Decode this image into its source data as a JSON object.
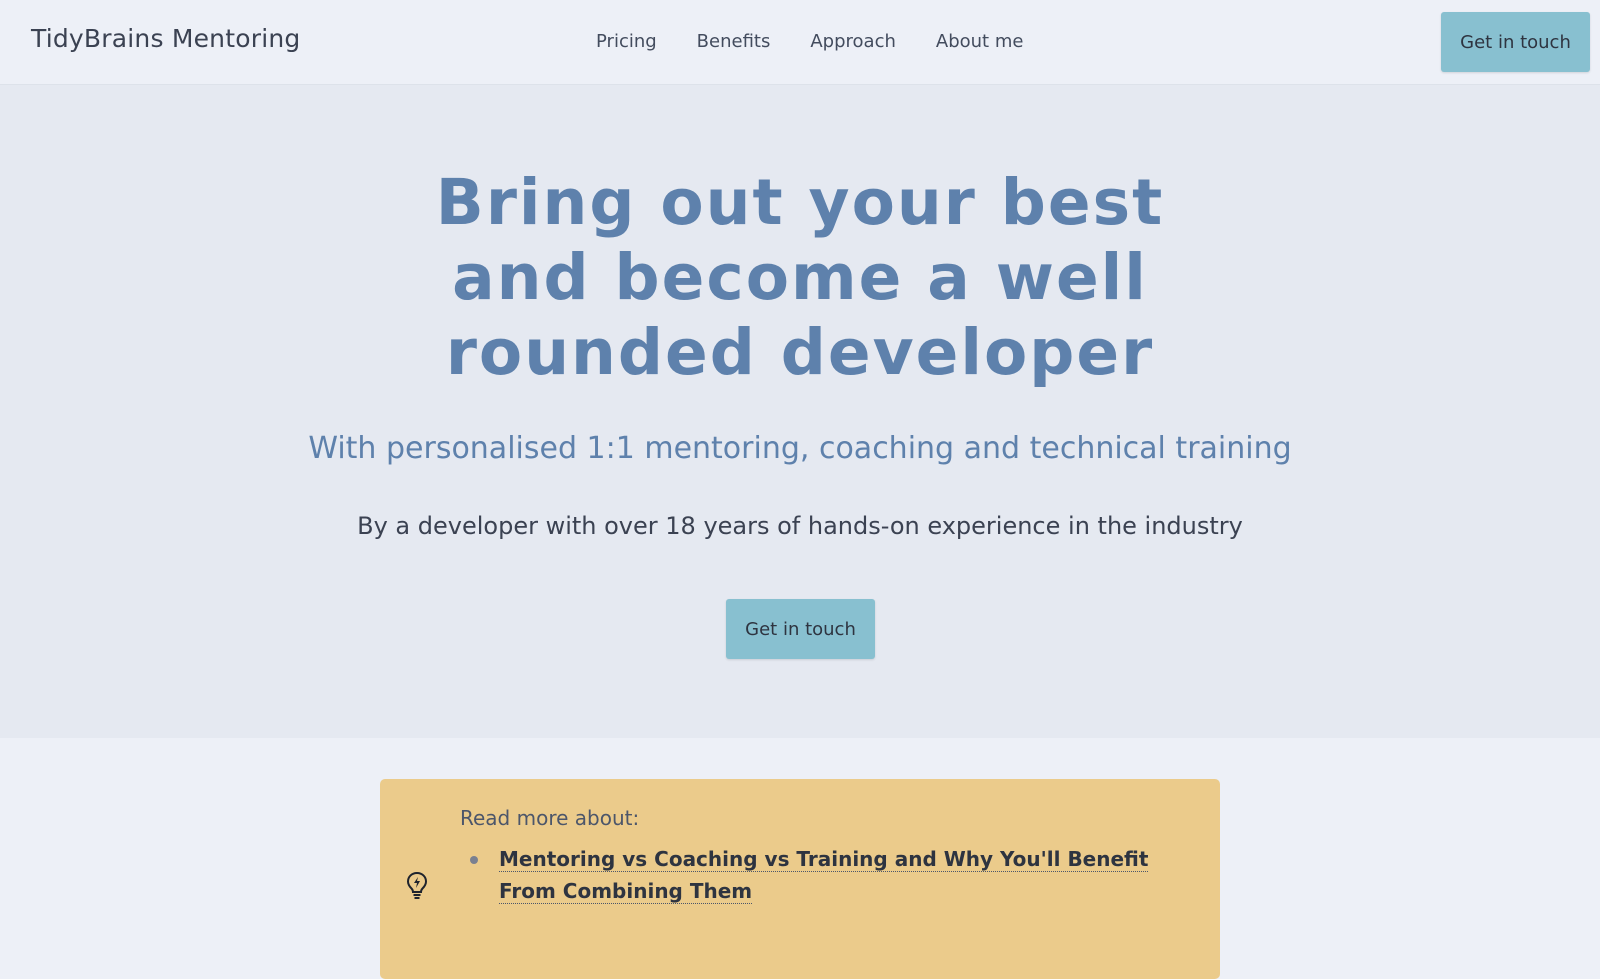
{
  "header": {
    "brand": "TidyBrains Mentoring",
    "nav": [
      "Pricing",
      "Benefits",
      "Approach",
      "About me"
    ],
    "cta_label": "Get in touch"
  },
  "hero": {
    "title": "Bring out your best and become a well rounded developer",
    "subtitle": "With personalised 1:1 mentoring, coaching and technical training",
    "tagline": "By a developer with over 18 years of hands-on experience in the industry",
    "cta_label": "Get in touch"
  },
  "read_more": {
    "heading": "Read more about:",
    "icon": "lightbulb-icon",
    "links": [
      "Mentoring vs Coaching vs Training and Why You'll Benefit From Combining Them"
    ]
  },
  "colors": {
    "accent": "#5e81ac",
    "button": "#88c0d0",
    "callout": "#ebcb8b"
  }
}
